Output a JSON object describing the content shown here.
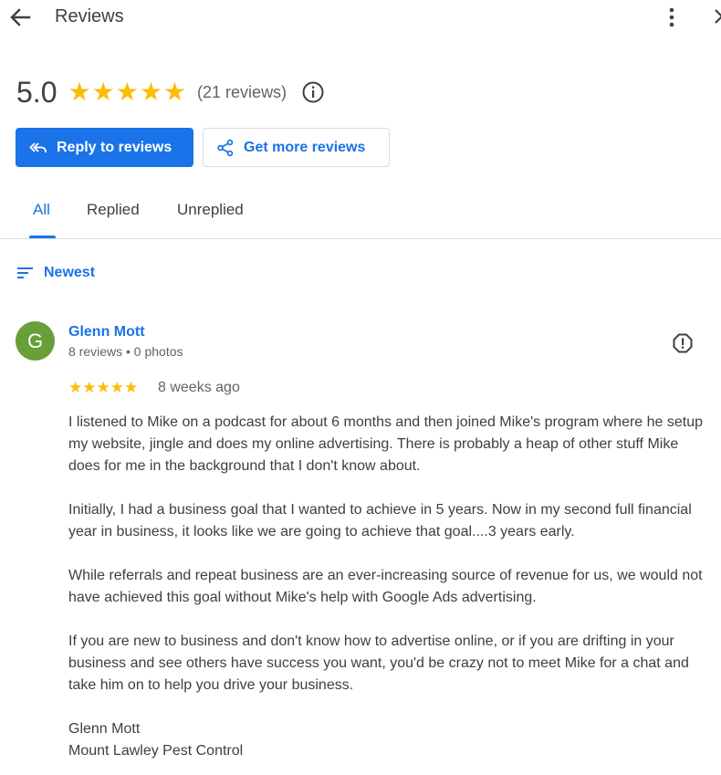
{
  "header": {
    "title": "Reviews",
    "back_icon": "arrow-left-icon",
    "more_icon": "more-vert-icon",
    "close_icon": "close-icon"
  },
  "summary": {
    "score": "5.0",
    "stars": 5,
    "count": "(21 reviews)",
    "info_icon": "info-icon"
  },
  "actions": {
    "reply_label": "Reply to reviews",
    "more_reviews_label": "Get more reviews"
  },
  "tabs": [
    {
      "label": "All",
      "active": true
    },
    {
      "label": "Replied",
      "active": false
    },
    {
      "label": "Unreplied",
      "active": false
    }
  ],
  "sort": {
    "label": "Newest"
  },
  "review": {
    "avatar_letter": "G",
    "avatar_color": "#689f38",
    "reviewer_name": "Glenn Mott",
    "reviewer_meta": "8 reviews • 0 photos",
    "rating": 5,
    "time": "8 weeks ago",
    "paragraphs": [
      "I listened to Mike on a podcast for about 6 months and then joined Mike's program where he setup my website, jingle and does my online advertising. There is probably a heap of other stuff Mike does for me in the background that I don't know about.",
      "Initially, I had a business goal that I wanted to achieve in 5 years. Now in my second full financial year in business, it looks like we are going to achieve that goal....3 years early.",
      "While referrals and repeat business are an ever-increasing source of revenue for us, we would not have achieved this goal without Mike's help with Google Ads advertising.",
      "If you are new to business and don't know how to advertise online, or if you are drifting in your business and see others have success you want, you'd be crazy not to meet Mike for a chat and take him on to help you drive your business."
    ],
    "signature_name": "Glenn Mott",
    "signature_company": "Mount Lawley Pest Control"
  },
  "colors": {
    "accent": "#1a73e8",
    "star": "#fbbc04",
    "text": "#3c4043",
    "muted": "#5f6368",
    "divider": "#dadce0"
  }
}
